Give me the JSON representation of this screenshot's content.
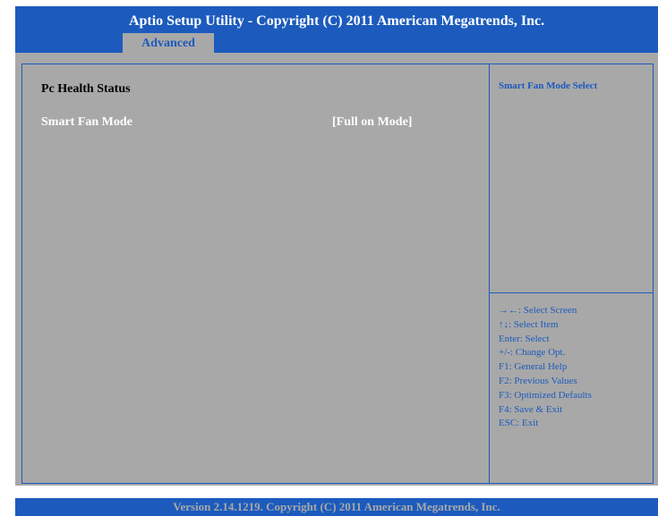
{
  "header": {
    "title": "Aptio Setup Utility  - Copyright (C) 2011 American Megatrends, Inc."
  },
  "tabs": [
    {
      "label": "Advanced",
      "active": true
    }
  ],
  "main": {
    "section_title": "Pc Health Status",
    "settings": [
      {
        "label": "Smart Fan Mode",
        "value": "[Full on Mode]"
      }
    ]
  },
  "help": {
    "title": "Smart Fan Mode Select",
    "keys": [
      "→←: Select Screen",
      "↑↓: Select Item",
      "Enter: Select",
      "+/-: Change Opt.",
      "F1: General Help",
      "F2: Previous Values",
      "F3: Optimized Defaults",
      "F4: Save & Exit",
      "ESC: Exit"
    ]
  },
  "footer": {
    "version": "Version 2.14.1219. Copyright (C) 2011 American Megatrends, Inc."
  },
  "colors": {
    "accent_blue": "#1c5bbd",
    "panel_gray": "#a8a8a8",
    "selected_text": "#ffffff",
    "normal_text": "#000000"
  }
}
